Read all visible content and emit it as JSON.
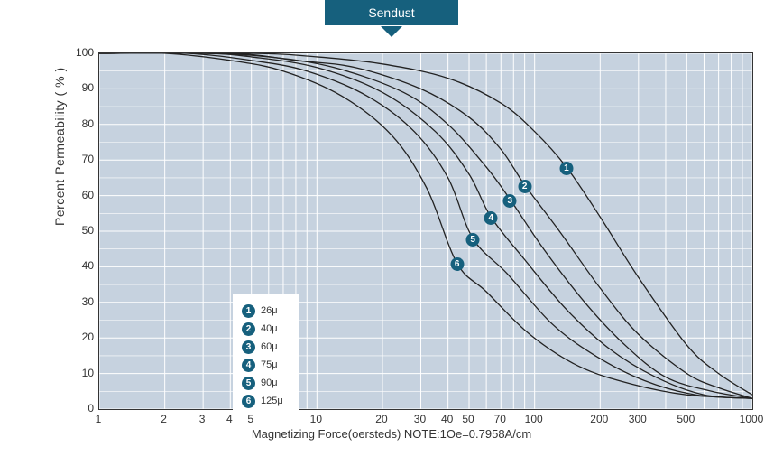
{
  "banner": "Sendust",
  "chart_data": {
    "type": "line",
    "title": "Sendust",
    "xlabel": "Magnetizing Force(oersteds)  NOTE:1Oe=0.7958A/cm",
    "ylabel": "Percent Permeability ( % )",
    "xscale": "log",
    "xlim": [
      1,
      1000
    ],
    "ylim": [
      0,
      100
    ],
    "xticks": [
      1,
      2,
      3,
      4,
      5,
      10,
      20,
      30,
      40,
      50,
      70,
      100,
      200,
      300,
      500,
      1000
    ],
    "yticks": [
      0,
      10,
      20,
      30,
      40,
      50,
      60,
      70,
      80,
      90,
      100
    ],
    "xgrid_minor": [
      1,
      2,
      3,
      4,
      5,
      6,
      7,
      8,
      9,
      10,
      20,
      30,
      40,
      50,
      60,
      70,
      80,
      90,
      100,
      200,
      300,
      400,
      500,
      600,
      700,
      800,
      900,
      1000
    ],
    "legend": [
      {
        "n": 1,
        "label": "26μ"
      },
      {
        "n": 2,
        "label": "40μ"
      },
      {
        "n": 3,
        "label": "60μ"
      },
      {
        "n": 4,
        "label": "75μ"
      },
      {
        "n": 5,
        "label": "90μ"
      },
      {
        "n": 6,
        "label": "125μ"
      }
    ],
    "markers": [
      {
        "n": 1,
        "x": 140,
        "y": 68
      },
      {
        "n": 2,
        "x": 90,
        "y": 63
      },
      {
        "n": 3,
        "x": 77,
        "y": 59
      },
      {
        "n": 4,
        "x": 63,
        "y": 54
      },
      {
        "n": 5,
        "x": 52,
        "y": 48
      },
      {
        "n": 6,
        "x": 44,
        "y": 41
      }
    ],
    "series": [
      {
        "name": "26μ",
        "points": [
          [
            1,
            100
          ],
          [
            5,
            100
          ],
          [
            10,
            99
          ],
          [
            20,
            97
          ],
          [
            40,
            93
          ],
          [
            70,
            86
          ],
          [
            100,
            78
          ],
          [
            140,
            68
          ],
          [
            200,
            54
          ],
          [
            300,
            37
          ],
          [
            500,
            18
          ],
          [
            700,
            10
          ],
          [
            1000,
            4
          ]
        ]
      },
      {
        "name": "40μ",
        "points": [
          [
            1,
            100
          ],
          [
            4,
            100
          ],
          [
            8,
            98
          ],
          [
            15,
            96
          ],
          [
            30,
            90
          ],
          [
            50,
            82
          ],
          [
            70,
            73
          ],
          [
            90,
            63
          ],
          [
            130,
            50
          ],
          [
            200,
            34
          ],
          [
            300,
            21
          ],
          [
            500,
            10
          ],
          [
            700,
            6
          ],
          [
            1000,
            3
          ]
        ]
      },
      {
        "name": "60μ",
        "points": [
          [
            1,
            100
          ],
          [
            3,
            100
          ],
          [
            6,
            99
          ],
          [
            12,
            96
          ],
          [
            25,
            89
          ],
          [
            40,
            80
          ],
          [
            60,
            68
          ],
          [
            77,
            59
          ],
          [
            110,
            45
          ],
          [
            170,
            30
          ],
          [
            260,
            18
          ],
          [
            400,
            9
          ],
          [
            650,
            5
          ],
          [
            1000,
            3
          ]
        ]
      },
      {
        "name": "75μ",
        "points": [
          [
            1,
            100
          ],
          [
            3,
            100
          ],
          [
            5,
            99
          ],
          [
            10,
            96
          ],
          [
            20,
            89
          ],
          [
            35,
            78
          ],
          [
            50,
            66
          ],
          [
            63,
            54
          ],
          [
            90,
            42
          ],
          [
            140,
            28
          ],
          [
            220,
            17
          ],
          [
            360,
            9
          ],
          [
            600,
            4
          ],
          [
            1000,
            3
          ]
        ]
      },
      {
        "name": "90μ",
        "points": [
          [
            1,
            100
          ],
          [
            2.5,
            100
          ],
          [
            5,
            98
          ],
          [
            9,
            95
          ],
          [
            17,
            88
          ],
          [
            28,
            78
          ],
          [
            40,
            65
          ],
          [
            52,
            48
          ],
          [
            75,
            38
          ],
          [
            120,
            24
          ],
          [
            190,
            15
          ],
          [
            320,
            8
          ],
          [
            550,
            4
          ],
          [
            1000,
            3
          ]
        ]
      },
      {
        "name": "125μ",
        "points": [
          [
            1,
            100
          ],
          [
            2,
            100
          ],
          [
            4,
            98
          ],
          [
            7,
            95
          ],
          [
            13,
            88
          ],
          [
            22,
            77
          ],
          [
            32,
            62
          ],
          [
            44,
            41
          ],
          [
            60,
            33
          ],
          [
            95,
            21
          ],
          [
            160,
            12
          ],
          [
            280,
            7
          ],
          [
            500,
            4
          ],
          [
            1000,
            3
          ]
        ]
      }
    ]
  }
}
